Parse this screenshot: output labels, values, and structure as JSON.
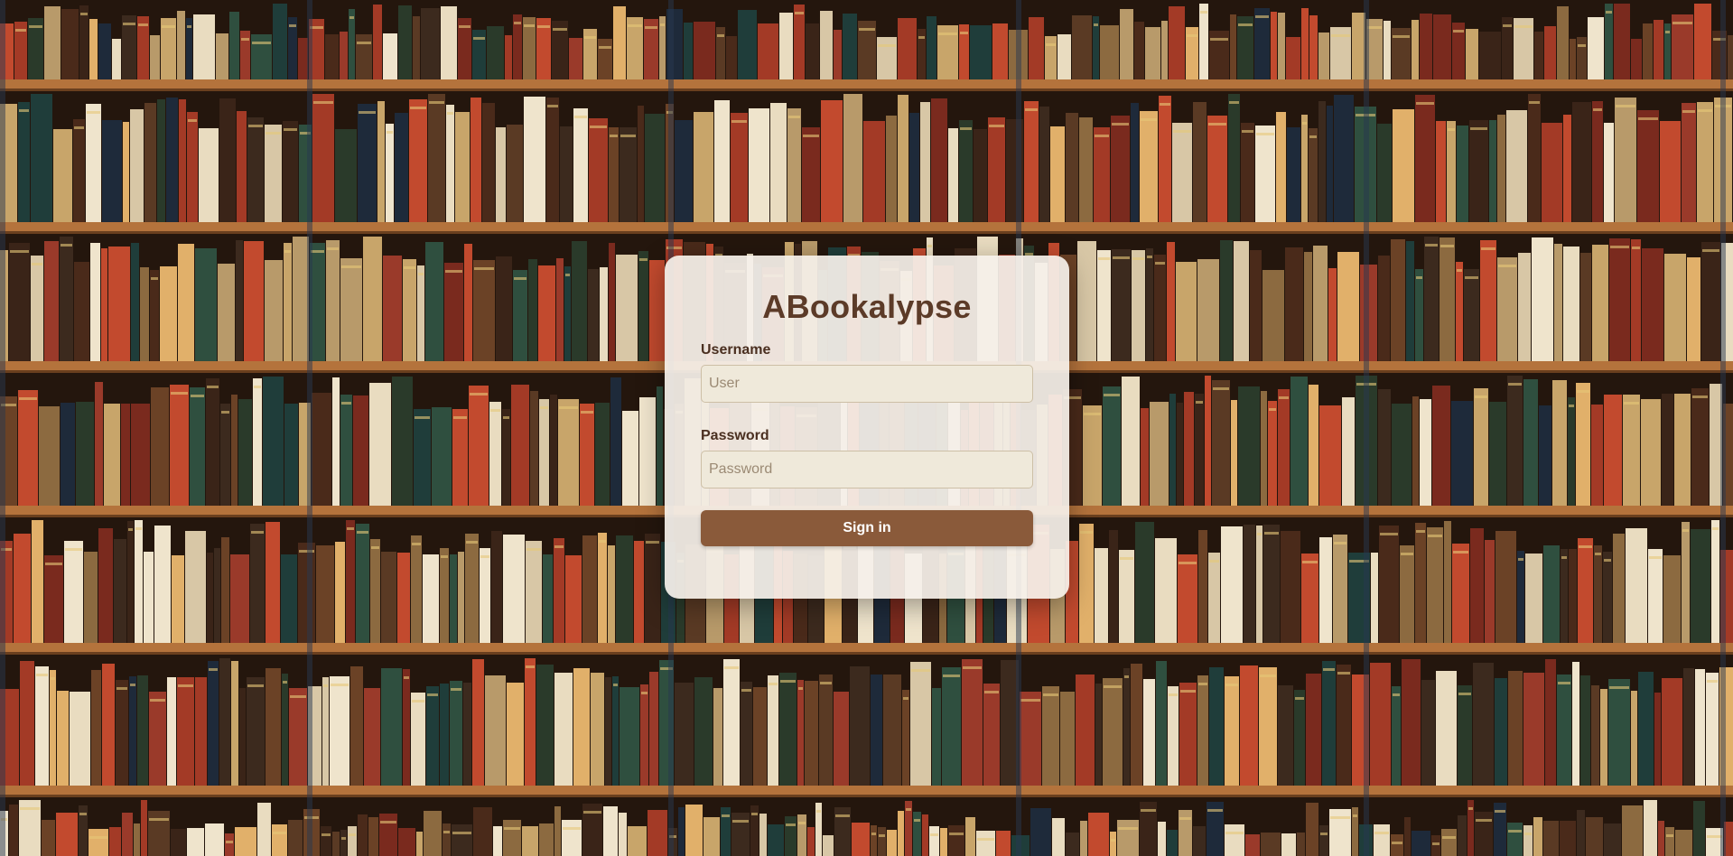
{
  "app": {
    "title": "ABookalypse"
  },
  "form": {
    "username": {
      "label": "Username",
      "placeholder": "User",
      "value": ""
    },
    "password": {
      "label": "Password",
      "placeholder": "Password",
      "value": ""
    },
    "submit_label": "Sign in"
  },
  "colors": {
    "title": "#5c3b28",
    "button": "#8a5a3a",
    "card": "#f5f0e9",
    "shelf": "#b4733c"
  }
}
